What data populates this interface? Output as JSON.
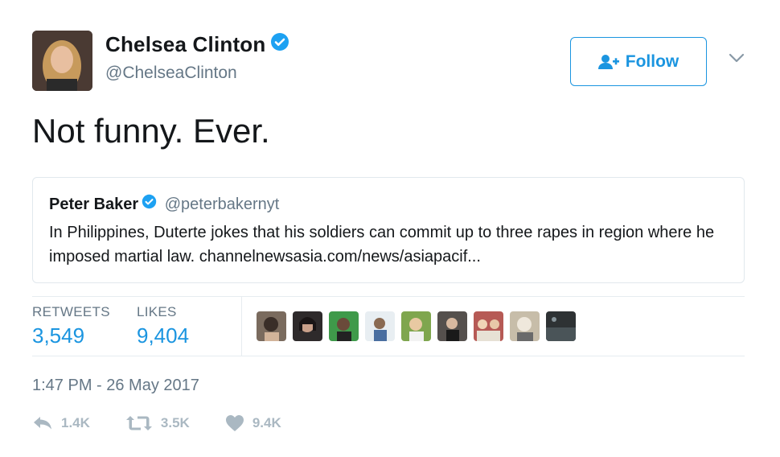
{
  "author": {
    "display_name": "Chelsea Clinton",
    "handle": "@ChelseaClinton",
    "verified": true
  },
  "follow_button": {
    "label": "Follow"
  },
  "tweet": {
    "text": "Not funny. Ever."
  },
  "quoted_tweet": {
    "display_name": "Peter Baker",
    "handle": "@peterbakernyt",
    "verified": true,
    "text": "In Philippines, Duterte jokes that his soldiers can commit up to three rapes in region where he imposed martial law. channelnewsasia.com/news/asiapacif..."
  },
  "stats": {
    "retweets_label": "RETWEETS",
    "retweets_value": "3,549",
    "likes_label": "LIKES",
    "likes_value": "9,404"
  },
  "liker_avatars": [
    "avatar-1",
    "avatar-2",
    "avatar-3",
    "avatar-4",
    "avatar-5",
    "avatar-6",
    "avatar-7",
    "avatar-8",
    "avatar-9"
  ],
  "timestamp": "1:47 PM - 26 May 2017",
  "actions": {
    "reply_count": "1.4K",
    "retweet_count": "3.5K",
    "like_count": "9.4K"
  },
  "colors": {
    "accent": "#1b95e0",
    "muted": "#657786",
    "icon_gray": "#aab8c2",
    "border": "#e1e8ed"
  }
}
